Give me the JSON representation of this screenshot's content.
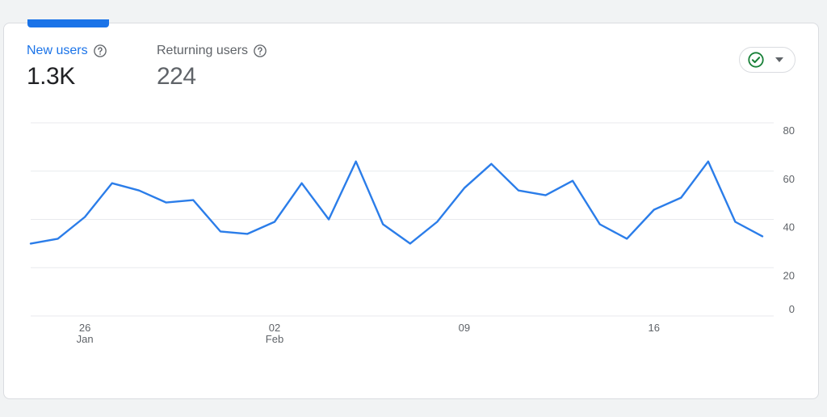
{
  "metrics": [
    {
      "label": "New users",
      "value": "1.3K",
      "selected": true
    },
    {
      "label": "Returning users",
      "value": "224",
      "selected": false
    }
  ],
  "compare_button": {
    "icon": "check-circle-icon",
    "dropdown_icon": "caret-down-icon"
  },
  "colors": {
    "accent": "#1a73e8",
    "line": "#2b7de9",
    "check": "#188038",
    "grid": "#e8eaed",
    "text_muted": "#5f6368"
  },
  "chart_data": {
    "type": "line",
    "title": "",
    "xlabel": "",
    "ylabel": "",
    "ylim": [
      0,
      80
    ],
    "y_ticks": [
      "80",
      "60",
      "40",
      "20",
      "0"
    ],
    "y_axis_position": "right",
    "grid": true,
    "x": [
      "2024-01-24",
      "2024-01-25",
      "2024-01-26",
      "2024-01-27",
      "2024-01-28",
      "2024-01-29",
      "2024-01-30",
      "2024-01-31",
      "2024-02-01",
      "2024-02-02",
      "2024-02-03",
      "2024-02-04",
      "2024-02-05",
      "2024-02-06",
      "2024-02-07",
      "2024-02-08",
      "2024-02-09",
      "2024-02-10",
      "2024-02-11",
      "2024-02-12",
      "2024-02-13",
      "2024-02-14",
      "2024-02-15",
      "2024-02-16",
      "2024-02-17",
      "2024-02-18",
      "2024-02-19",
      "2024-02-20"
    ],
    "x_ticks": [
      {
        "date": "2024-01-26",
        "day": "26",
        "month": "Jan"
      },
      {
        "date": "2024-02-02",
        "day": "02",
        "month": "Feb"
      },
      {
        "date": "2024-02-09",
        "day": "09",
        "month": ""
      },
      {
        "date": "2024-02-16",
        "day": "16",
        "month": ""
      }
    ],
    "series": [
      {
        "values": [
          30,
          32,
          41,
          55,
          52,
          47,
          48,
          35,
          34,
          39,
          55,
          40,
          64,
          38,
          30,
          39,
          53,
          63,
          52,
          50,
          56,
          38,
          32,
          44,
          49,
          64,
          39,
          33
        ]
      }
    ]
  }
}
